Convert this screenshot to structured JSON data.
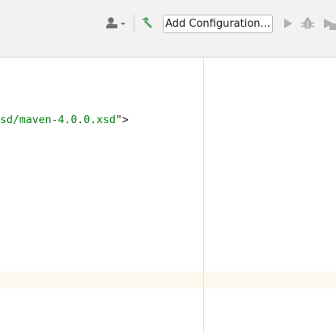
{
  "toolbar": {
    "user_icon": "user-dropdown-icon",
    "build_icon": "hammer-build-icon",
    "add_configuration_label": "Add Configuration...",
    "run_icon": "run-play-icon",
    "debug_icon": "debug-bug-icon",
    "coverage_icon": "run-with-coverage-icon"
  },
  "editor": {
    "code_visible_fragment": "sd/maven-4.0.0.xsd",
    "code_closing": "\">"
  },
  "colors": {
    "toolbar_bg": "#f2f2f2",
    "string_green": "#067d17",
    "build_green": "#59a869",
    "current_line": "#fdfbef",
    "icon_gray": "#6e6e6e",
    "disabled_gray": "#b0b0b0"
  }
}
